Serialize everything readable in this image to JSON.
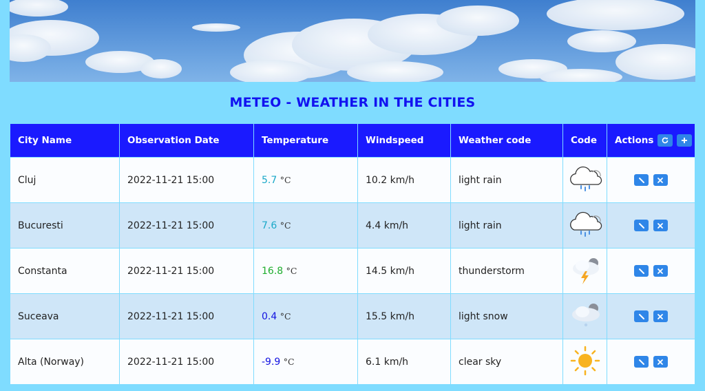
{
  "page": {
    "title": "METEO - WEATHER IN THE CITIES"
  },
  "colors": {
    "background": "#7fdcff",
    "header_bg": "#1a1aff",
    "row_odd": "#fbfdff",
    "row_even": "#cfe6f8",
    "action_button": "#2f86e8",
    "temp_cool": "#1aa8c8",
    "temp_warm": "#1fae2e",
    "temp_cold": "#1212e0"
  },
  "table": {
    "headers": {
      "city": "City Name",
      "date": "Observation Date",
      "temp": "Temperature",
      "wind": "Windspeed",
      "weather": "Weather code",
      "code": "Code",
      "actions": "Actions"
    },
    "header_actions": [
      "refresh-icon",
      "plus-icon"
    ],
    "rows": [
      {
        "city": "Cluj",
        "date": "2022-11-21 15:00",
        "temp": "5.7",
        "unit": "°C",
        "temp_color": "#1aa8c8",
        "wind": "10.2 km/h",
        "weather": "light rain",
        "icon": "rain-cloud-icon"
      },
      {
        "city": "Bucuresti",
        "date": "2022-11-21 15:00",
        "temp": "7.6",
        "unit": "°C",
        "temp_color": "#1aa8c8",
        "wind": "4.4 km/h",
        "weather": "light rain",
        "icon": "rain-cloud-icon"
      },
      {
        "city": "Constanta",
        "date": "2022-11-21 15:00",
        "temp": "16.8",
        "unit": "°C",
        "temp_color": "#1fae2e",
        "wind": "14.5 km/h",
        "weather": "thunderstorm",
        "icon": "thunderstorm-icon"
      },
      {
        "city": "Suceava",
        "date": "2022-11-21 15:00",
        "temp": "0.4",
        "unit": "°C",
        "temp_color": "#1212e0",
        "wind": "15.5 km/h",
        "weather": "light snow",
        "icon": "snow-cloud-icon"
      },
      {
        "city": "Alta (Norway)",
        "date": "2022-11-21 15:00",
        "temp": "-9.9",
        "unit": "°C",
        "temp_color": "#1212e0",
        "wind": "6.1 km/h",
        "weather": "clear sky",
        "icon": "sun-icon"
      }
    ],
    "row_actions": [
      "edit-icon",
      "delete-icon"
    ]
  }
}
